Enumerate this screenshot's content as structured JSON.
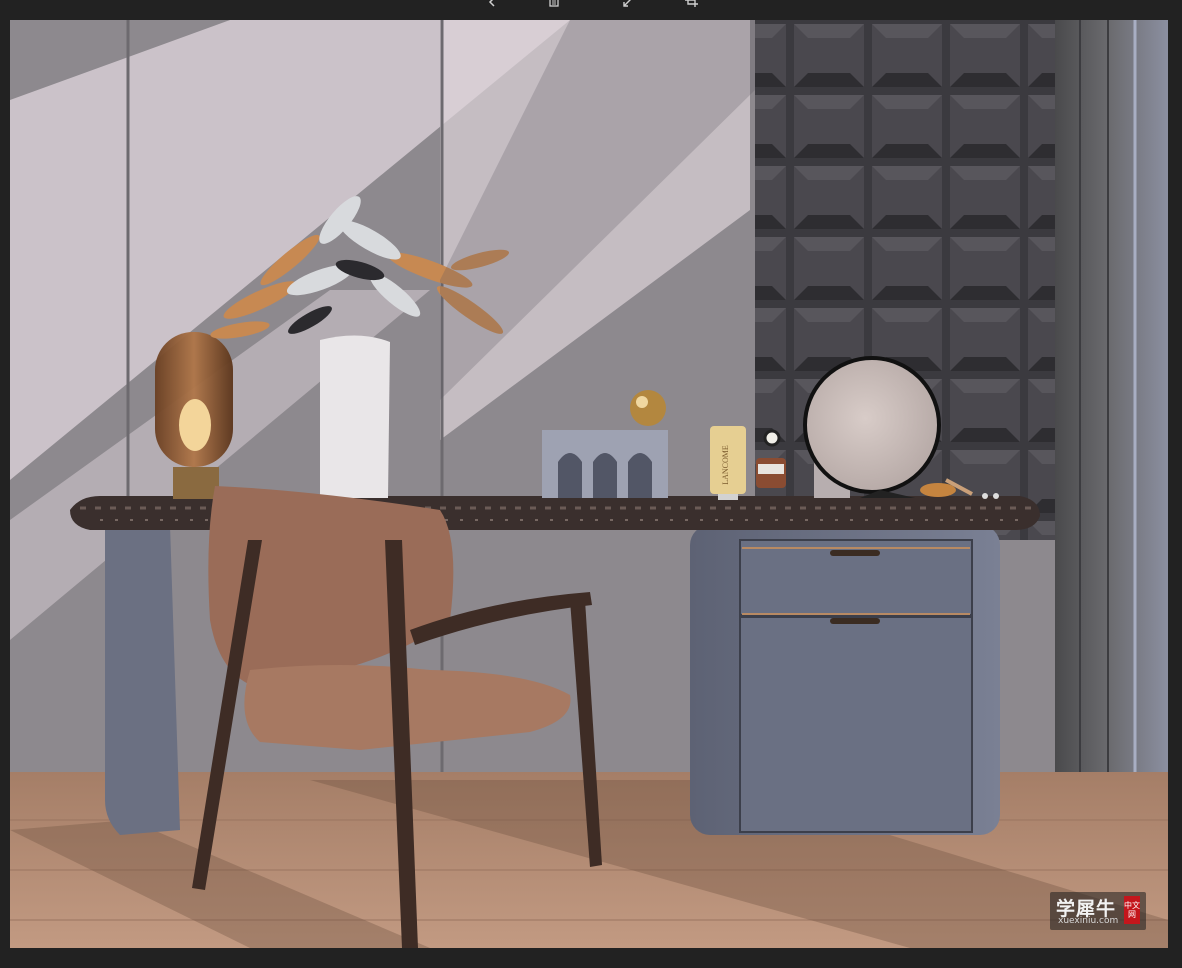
{
  "toolbar": {
    "buttons": [
      {
        "icon": "chevron-left-icon"
      },
      {
        "icon": "trash-icon"
      },
      {
        "icon": "expand-icon"
      },
      {
        "icon": "crop-icon"
      }
    ]
  },
  "scene": {
    "product_label": "LANCOME"
  },
  "watermark": {
    "title": "学犀牛",
    "sub": "xuexiniu.com",
    "seal": "中文网"
  }
}
